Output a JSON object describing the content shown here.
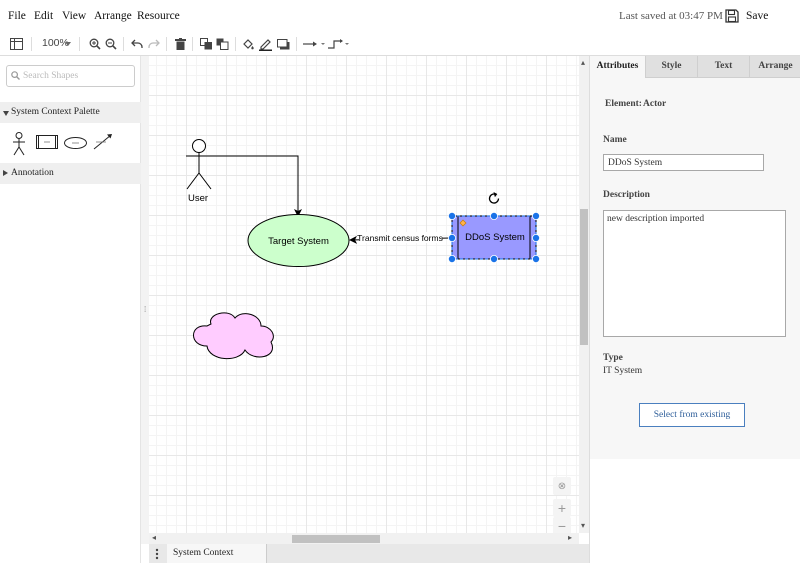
{
  "menu": {
    "items": [
      "File",
      "Edit",
      "View",
      "Arrange",
      "Resource"
    ]
  },
  "header": {
    "saved_text": "Last saved at 03:47 PM",
    "save_label": "Save"
  },
  "toolbar": {
    "zoom": "100%"
  },
  "sidebar": {
    "search_placeholder": "Search Shapes",
    "palette_title": "System Context Palette",
    "annotation_title": "Annotation"
  },
  "diagram": {
    "actor_label": "User",
    "ellipse_label": "Target System",
    "rect_label": "DDoS System",
    "edge_label": "Transmit census forms",
    "colors": {
      "ellipse_fill": "#ccffcc",
      "rect_fill": "#9999ff",
      "cloud_fill": "#ffccff",
      "selection": "#1a73e8"
    }
  },
  "pages": {
    "current": "System Context"
  },
  "panel": {
    "tabs": [
      "Attributes",
      "Style",
      "Text",
      "Arrange"
    ],
    "active_tab": "Attributes",
    "element_label": "Element:",
    "element_value": "Actor",
    "name_label": "Name",
    "name_value": "DDoS System",
    "description_label": "Description",
    "description_value": "new description imported",
    "type_label": "Type",
    "type_value": "IT System",
    "select_button": "Select from existing"
  }
}
